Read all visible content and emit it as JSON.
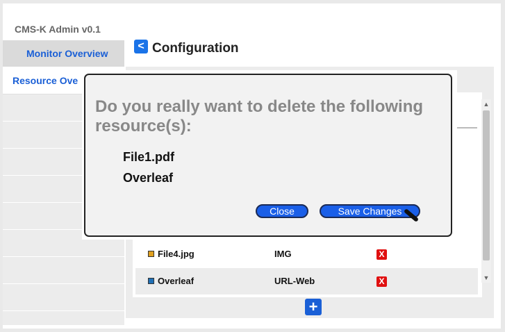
{
  "app": {
    "title": "CMS-K Admin v0.1"
  },
  "sidebar": {
    "items": [
      {
        "label": "Monitor Overview"
      },
      {
        "label": "Resource Ove"
      }
    ]
  },
  "header": {
    "back_icon": "chevron-left-icon",
    "back_glyph": "<",
    "title": "Configuration"
  },
  "table": {
    "rows": [
      {
        "name": "File4.jpg",
        "type": "IMG",
        "color": "#e0a020",
        "delete_glyph": "X"
      },
      {
        "name": "Overleaf",
        "type": "URL-Web",
        "color": "#1f6fb5",
        "delete_glyph": "X"
      }
    ]
  },
  "scrollbar": {
    "up_glyph": "▲",
    "down_glyph": "▼"
  },
  "add_button": {
    "glyph": "+"
  },
  "modal": {
    "title": "Do you really want to delete the following resource(s):",
    "items": [
      "File1.pdf",
      "Overleaf"
    ],
    "close_label": "Close",
    "save_label": "Save Changes"
  },
  "colors": {
    "accent": "#1a5fd6",
    "danger": "#e01010",
    "panel": "#ececec"
  }
}
